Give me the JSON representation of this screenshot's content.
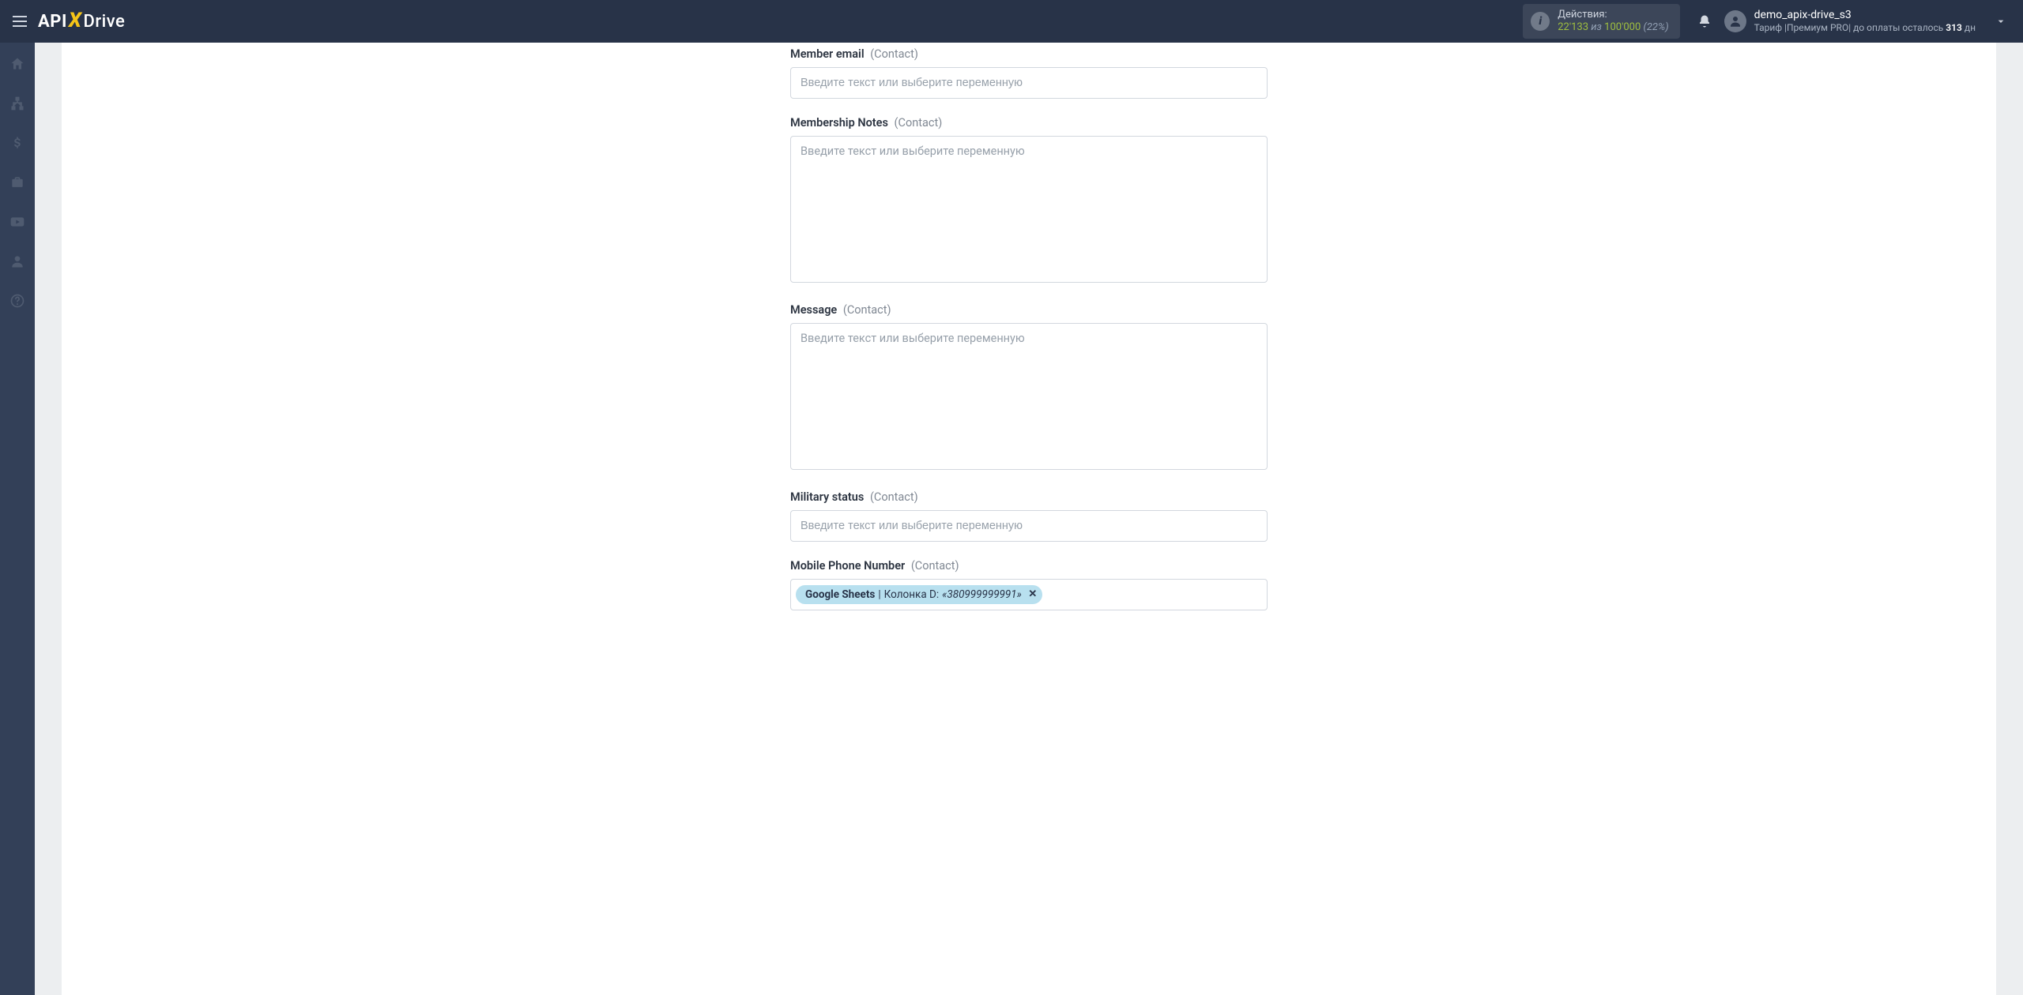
{
  "brand": {
    "part1": "API",
    "x": "X",
    "part2": "Drive"
  },
  "header": {
    "actions": {
      "label": "Действия:",
      "used": "22'133",
      "of_word": " из ",
      "total": "100'000",
      "pct": "(22%)"
    },
    "user": {
      "name": "demo_apix-drive_s3",
      "sub_prefix": "Тариф |Премиум PRO|  до оплаты осталось ",
      "sub_days": "313",
      "sub_suffix": " дн"
    }
  },
  "sidebar": {
    "items": [
      "home",
      "sitemap",
      "dollar",
      "briefcase",
      "youtube",
      "user",
      "help"
    ]
  },
  "form": {
    "placeholder": "Введите текст или выберите переменную",
    "fields": [
      {
        "label": "Member email",
        "suffix": "(Contact)",
        "type": "input"
      },
      {
        "label": "Membership Notes",
        "suffix": "(Contact)",
        "type": "textarea"
      },
      {
        "label": "Message",
        "suffix": "(Contact)",
        "type": "textarea"
      },
      {
        "label": "Military status",
        "suffix": "(Contact)",
        "type": "input"
      },
      {
        "label": "Mobile Phone Number",
        "suffix": "(Contact)",
        "type": "chips",
        "chips": [
          {
            "source": "Google Sheets",
            "column": "Колонка D:",
            "value": "«380999999991»"
          }
        ]
      }
    ]
  }
}
